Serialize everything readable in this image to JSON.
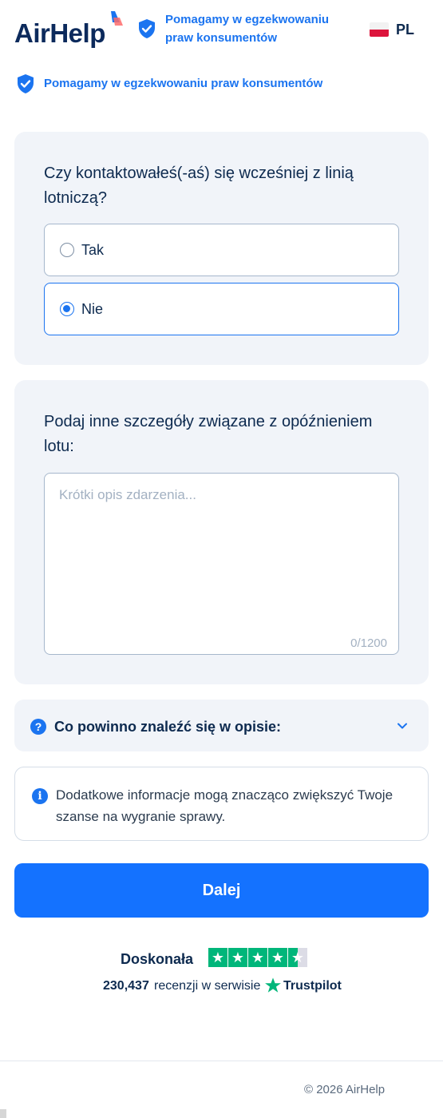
{
  "header": {
    "logo_text": "AirHelp",
    "badge_text": "Pomagamy w egzekwowaniu praw konsumentów",
    "language": "PL",
    "flag_icon": "poland-flag-icon"
  },
  "trust_line": {
    "text": "Pomagamy w egzekwowaniu praw konsumentów"
  },
  "contact_question": {
    "question": "Czy kontaktowałeś(-aś) się wcześniej z linią lotniczą?",
    "options": [
      {
        "label": "Tak",
        "selected": false
      },
      {
        "label": "Nie",
        "selected": true
      }
    ]
  },
  "details": {
    "question": "Podaj inne szczegóły związane z opóźnieniem lotu:",
    "placeholder": "Krótki opis zdarzenia...",
    "value": "",
    "counter": "0/1200"
  },
  "accordion": {
    "label": "Co powinno znaleźć się w opisie:",
    "icon": "question-icon",
    "expanded": false
  },
  "info": {
    "text": "Dodatkowe informacje mogą znacząco zwiększyć Twoje szanse na wygranie sprawy."
  },
  "primary_button": {
    "label": "Dalej",
    "color": "#1472ff"
  },
  "trustpilot": {
    "rating_label": "Doskonała",
    "stars": 4.5,
    "review_count": "230,437",
    "review_text": "recenzji w serwisie",
    "brand": "Trustpilot",
    "star_color": "#00b67a"
  },
  "footer": {
    "copyright": "© 2026 AirHelp"
  },
  "colors": {
    "accent": "#1b74f0",
    "text": "#0d2a4f",
    "card_bg": "#f1f4f9"
  }
}
